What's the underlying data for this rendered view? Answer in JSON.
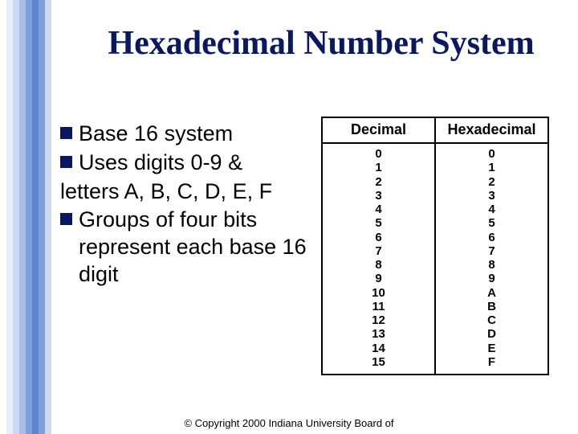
{
  "title": "Hexadecimal Number System",
  "bullets": {
    "b1": "Base 16 system",
    "b2": "Uses digits 0-9 &",
    "b2_cont": "letters A, B, C, D, E, F",
    "b3": "Groups of four bits represent each base 16 digit"
  },
  "table": {
    "header_dec": "Decimal",
    "header_hex": "Hexadecimal",
    "dec": [
      "0",
      "1",
      "2",
      "3",
      "4",
      "5",
      "6",
      "7",
      "8",
      "9",
      "10",
      "11",
      "12",
      "13",
      "14",
      "15"
    ],
    "hex": [
      "0",
      "1",
      "2",
      "3",
      "4",
      "5",
      "6",
      "7",
      "8",
      "9",
      "A",
      "B",
      "C",
      "D",
      "E",
      "F"
    ]
  },
  "footer": "© Copyright 2000 Indiana University Board of",
  "stripes": [
    {
      "x": 0,
      "w": 8,
      "c": "#ffffff"
    },
    {
      "x": 8,
      "w": 8,
      "c": "#e9effa"
    },
    {
      "x": 16,
      "w": 8,
      "c": "#cdd9f1"
    },
    {
      "x": 24,
      "w": 8,
      "c": "#a8bde6"
    },
    {
      "x": 32,
      "w": 8,
      "c": "#7e9ddb"
    },
    {
      "x": 40,
      "w": 8,
      "c": "#5e84d0"
    },
    {
      "x": 48,
      "w": 8,
      "c": "#7e9ddb"
    },
    {
      "x": 56,
      "w": 8,
      "c": "#cdd9f1"
    }
  ]
}
